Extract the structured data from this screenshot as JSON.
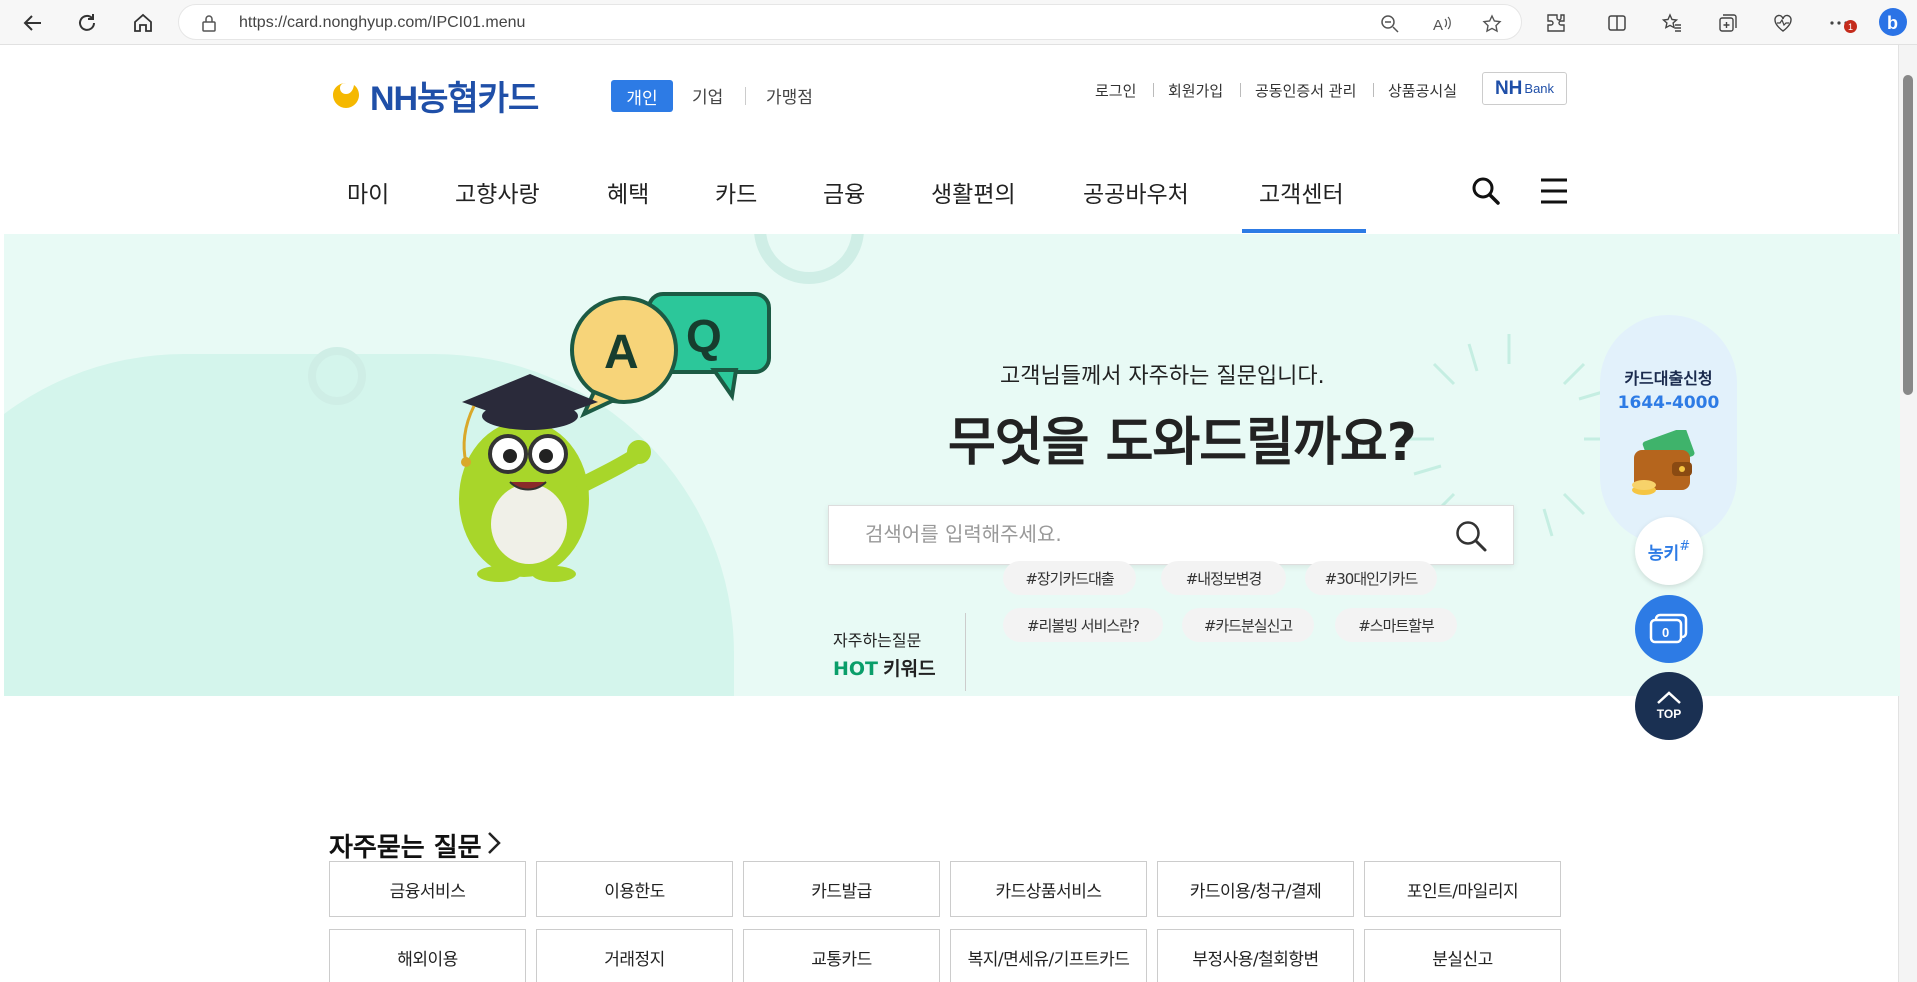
{
  "browser": {
    "url": "https://card.nonghyup.com/IPCI01.menu",
    "notification_count": "1"
  },
  "header": {
    "logo_text": "NH농협카드",
    "segments": [
      "개인",
      "기업",
      "가맹점"
    ],
    "util_links": [
      "로그인",
      "회원가입",
      "공동인증서 관리",
      "상품공시실"
    ],
    "nhbank": {
      "main": "NH",
      "sub": "Bank"
    }
  },
  "gnb": {
    "items": [
      "마이",
      "고향사랑",
      "혜택",
      "카드",
      "금융",
      "생활편의",
      "공공바우처",
      "고객센터"
    ],
    "active": "고객센터"
  },
  "hero": {
    "subtitle": "고객님들께서 자주하는 질문입니다.",
    "title": "무엇을 도와드릴까요?",
    "search_placeholder": "검색어를 입력해주세요.",
    "hot_label_top": "자주하는질문",
    "hot_label_hot": "HOT",
    "hot_label_kw": "키워드",
    "tags": [
      "#장기카드대출",
      "#내정보변경",
      "#30대인기카드",
      "#리볼빙 서비스란?",
      "#카드분실신고",
      "#스마트할부"
    ],
    "bubble_a": "A",
    "bubble_q": "Q"
  },
  "quick": {
    "title": "카드대출신청",
    "phone": "1644-4000",
    "nongki_label": "농키",
    "count": "0",
    "top_label": "TOP"
  },
  "faq": {
    "title": "자주묻는 질문",
    "categories": [
      "금융서비스",
      "이용한도",
      "카드발급",
      "카드상품서비스",
      "카드이용/청구/결제",
      "포인트/마일리지",
      "해외이용",
      "거래정지",
      "교통카드",
      "복지/면세유/기프트카드",
      "부정사용/철회항변",
      "분실신고"
    ]
  },
  "colors": {
    "accent": "#2d7be5",
    "hero_bg": "#e8faf5",
    "navy": "#1a3052",
    "brand": "#1f4fa8",
    "brand_yellow": "#f5b800"
  }
}
